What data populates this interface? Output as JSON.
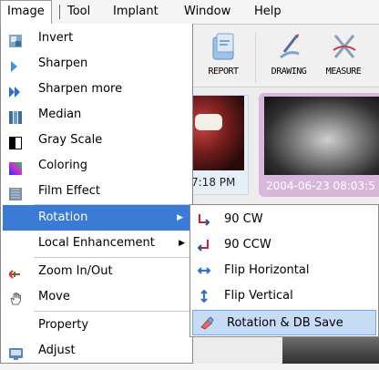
{
  "menubar": {
    "items": [
      "Image",
      "Tool",
      "Implant",
      "Window",
      "Help"
    ]
  },
  "toolbar": {
    "buttons": [
      "REPORT",
      "DRAWING",
      "MEASURE"
    ]
  },
  "thumbnails": [
    {
      "date": "7:18 PM"
    },
    {
      "date": "2004-06-23 08:03:5"
    }
  ],
  "image_menu": {
    "items": [
      {
        "label": "Invert",
        "icon": "invert-icon"
      },
      {
        "label": "Sharpen",
        "icon": "sharpen-icon"
      },
      {
        "label": "Sharpen more",
        "icon": "sharpen-more-icon"
      },
      {
        "label": "Median",
        "icon": "median-icon"
      },
      {
        "label": "Gray Scale",
        "icon": "gray-scale-icon"
      },
      {
        "label": "Coloring",
        "icon": "coloring-icon"
      },
      {
        "label": "Film Effect",
        "icon": "film-effect-icon"
      },
      {
        "label": "Rotation",
        "icon": "",
        "submenu": true
      },
      {
        "label": "Local Enhancement",
        "icon": "",
        "submenu": true
      },
      {
        "label": "Zoom In/Out",
        "icon": "zoom-icon"
      },
      {
        "label": "Move",
        "icon": "hand-icon"
      },
      {
        "label": "Property",
        "icon": ""
      },
      {
        "label": "Adjust",
        "icon": "adjust-icon"
      }
    ],
    "selected": "Rotation"
  },
  "rotation_submenu": {
    "items": [
      {
        "label": "90 CW",
        "icon": "rotate-cw-icon"
      },
      {
        "label": "90 CCW",
        "icon": "rotate-ccw-icon"
      },
      {
        "label": "Flip Horizontal",
        "icon": "flip-horizontal-icon"
      },
      {
        "label": "Flip Vertical",
        "icon": "flip-vertical-icon"
      },
      {
        "label": "Rotation & DB Save",
        "icon": "rotation-db-save-icon"
      }
    ],
    "highlighted": "Rotation & DB Save"
  },
  "colors": {
    "selection": "#3a7bd5",
    "hover": "#c6dbf5",
    "thumb_selected_bg": "#d9b7dc"
  }
}
